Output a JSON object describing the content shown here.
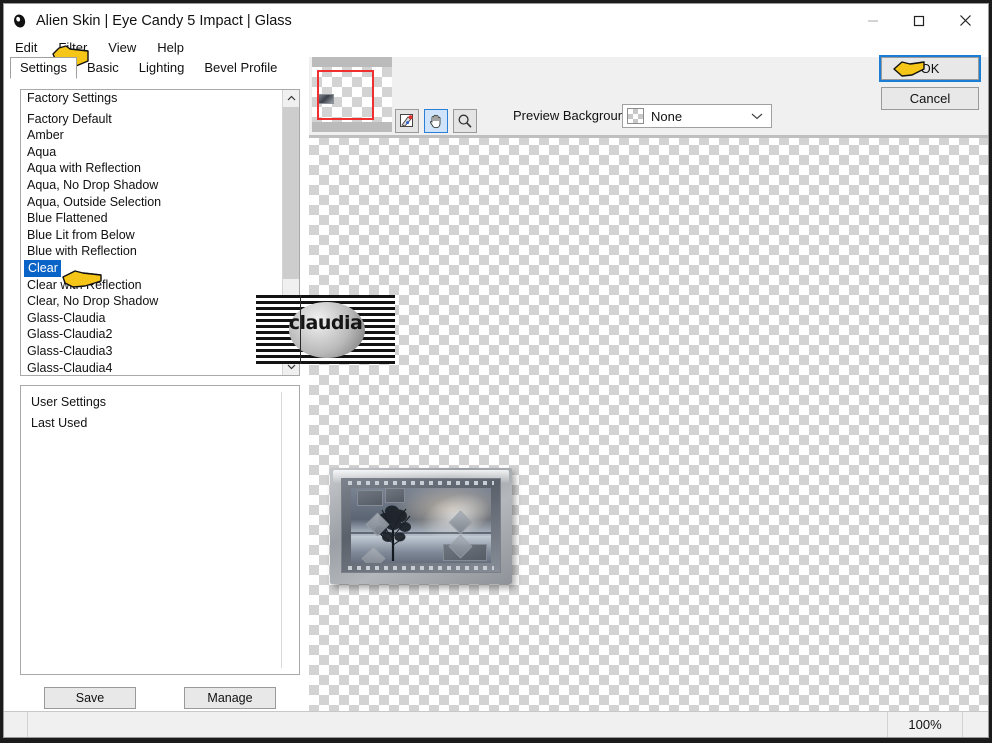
{
  "window": {
    "title": "Alien Skin | Eye Candy 5 Impact | Glass",
    "icon": "alien-eye-icon",
    "controls": {
      "minimize": "minimize-icon",
      "maximize": "maximize-icon",
      "close": "close-icon"
    }
  },
  "menu": {
    "items": [
      "Edit",
      "Filter",
      "View",
      "Help"
    ]
  },
  "tabs": [
    {
      "label": "Settings",
      "active": true
    },
    {
      "label": "Basic",
      "active": false
    },
    {
      "label": "Lighting",
      "active": false
    },
    {
      "label": "Bevel Profile",
      "active": false
    }
  ],
  "presets": {
    "group_label": "Factory Settings",
    "items": [
      {
        "label": "Factory Default",
        "selected": false
      },
      {
        "label": "Amber",
        "selected": false
      },
      {
        "label": "Aqua",
        "selected": false
      },
      {
        "label": "Aqua with Reflection",
        "selected": false
      },
      {
        "label": "Aqua, No Drop Shadow",
        "selected": false
      },
      {
        "label": "Aqua, Outside Selection",
        "selected": false
      },
      {
        "label": "Blue Flattened",
        "selected": false
      },
      {
        "label": "Blue Lit from Below",
        "selected": false
      },
      {
        "label": "Blue with Reflection",
        "selected": false
      },
      {
        "label": "Clear",
        "selected": true
      },
      {
        "label": "Clear with Reflection",
        "selected": false
      },
      {
        "label": "Clear, No Drop Shadow",
        "selected": false
      },
      {
        "label": "Glass-Claudia",
        "selected": false
      },
      {
        "label": "Glass-Claudia2",
        "selected": false
      },
      {
        "label": "Glass-Claudia3",
        "selected": false
      },
      {
        "label": "Glass-Claudia4",
        "selected": false
      }
    ]
  },
  "user_presets": {
    "items": [
      {
        "label": "User Settings"
      },
      {
        "label": "Last Used"
      }
    ]
  },
  "panel_buttons": {
    "save": "Save",
    "manage": "Manage"
  },
  "tools": [
    {
      "name": "eyedropper-tool",
      "active": false
    },
    {
      "name": "hand-tool",
      "active": true
    },
    {
      "name": "zoom-tool",
      "active": false
    }
  ],
  "preview_background": {
    "label": "Preview Background:",
    "value": "None",
    "swatch": "transparent-checker-swatch",
    "options": [
      "None"
    ]
  },
  "dialog_buttons": {
    "ok": "OK",
    "cancel": "Cancel"
  },
  "statusbar": {
    "zoom": "100%"
  },
  "watermark": {
    "text": "claudia"
  },
  "colors": {
    "selection_blue": "#0a64c8",
    "focus_blue": "#1a7fd4",
    "panel_gray": "#f0f0f0",
    "checker_gray": "#d3d3d3",
    "navigator_viewport_red": "#f03030",
    "tool_active_blue": "#cfe4fa"
  }
}
